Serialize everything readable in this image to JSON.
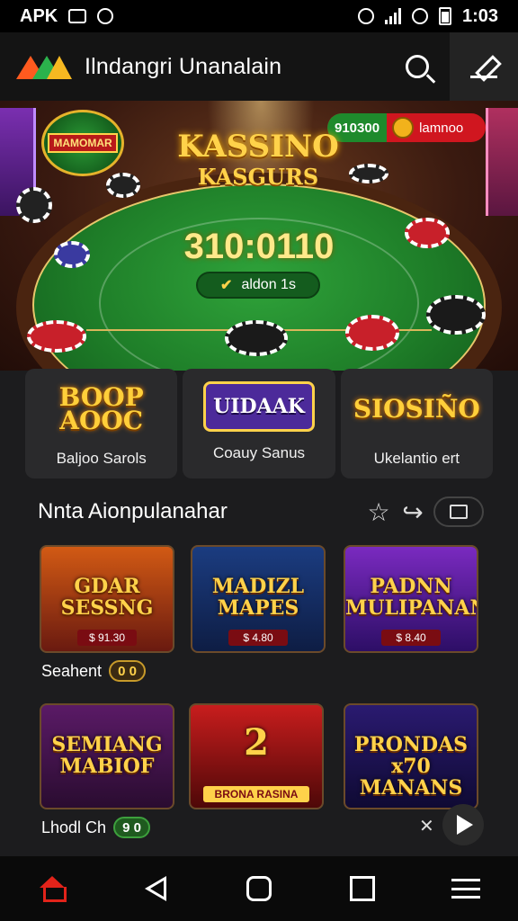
{
  "status_bar": {
    "left_text": "APK",
    "time": "1:03"
  },
  "app_bar": {
    "title": "Ilndangri Unanalain"
  },
  "hero": {
    "title": "KASSINO",
    "subtitle": "KASGURS",
    "counter": "310:0110",
    "pill_label": "aldon 1s",
    "badge_left": "MAMOMAR",
    "badge_right_value": "910300",
    "badge_right_label": "lamnoo"
  },
  "categories": [
    {
      "logo": "BOOP AOOC",
      "label": "Baljoo Sarols"
    },
    {
      "logo": "UIDAAK",
      "label": "Coauy Sanus"
    },
    {
      "logo": "SIOSIÑO",
      "label": "Ukelantio ert"
    }
  ],
  "section": {
    "title": "Nnta Aionpulanahar"
  },
  "games": [
    {
      "title": "GDAR SESSNG",
      "price": "$ 91.30"
    },
    {
      "title": "MADIZL MAPES",
      "price": "$ 4.80"
    },
    {
      "title": "PADNN MULIPANAN",
      "price": "$ 8.40"
    },
    {
      "title": "SEMIANG MABIOF",
      "price": ""
    },
    {
      "title": "2",
      "price": "BRONA RASINA"
    },
    {
      "title": "PRONDAS x70 MANANS",
      "price": ""
    }
  ],
  "rows": [
    {
      "label": "Seahent",
      "pill": "0 0"
    },
    {
      "label": "Lhodl Ch",
      "pill": "9 0"
    }
  ],
  "colors": {
    "accent": "#e2231a",
    "gold": "#ffd24a",
    "felt": "#1e7d28"
  }
}
